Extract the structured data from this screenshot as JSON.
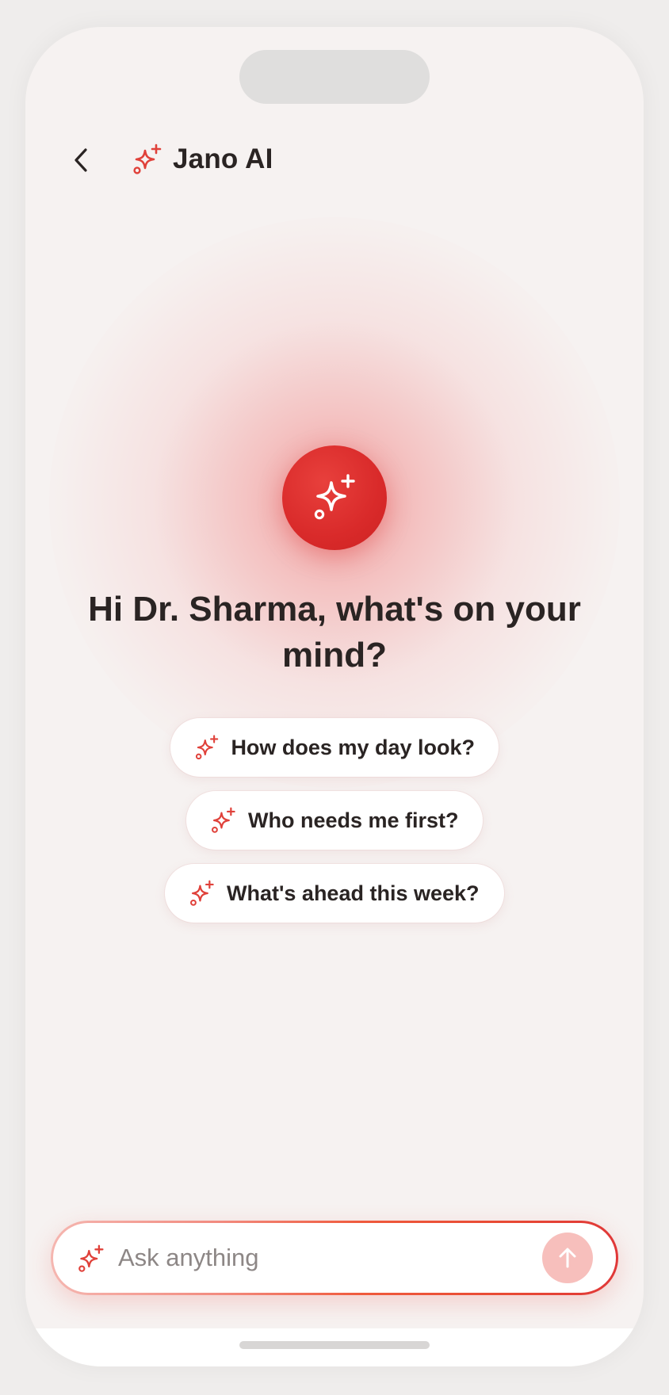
{
  "header": {
    "title": "Jano AI",
    "back_icon": "chevron-left-icon",
    "title_icon": "sparkles-icon"
  },
  "hero": {
    "icon": "sparkles-icon",
    "greeting": "Hi Dr. Sharma, what's on your mind?"
  },
  "suggestions": [
    {
      "label": "How does my day look?",
      "icon": "sparkles-icon"
    },
    {
      "label": "Who needs me first?",
      "icon": "sparkles-icon"
    },
    {
      "label": "What's ahead this week?",
      "icon": "sparkles-icon"
    }
  ],
  "composer": {
    "placeholder": "Ask anything",
    "value": "",
    "icon": "sparkles-icon",
    "send_icon": "arrow-up-icon"
  },
  "colors": {
    "accent": "#d92a2a",
    "accent_light": "#f7bfbc",
    "background": "#f6f2f1",
    "text": "#2a2423"
  }
}
